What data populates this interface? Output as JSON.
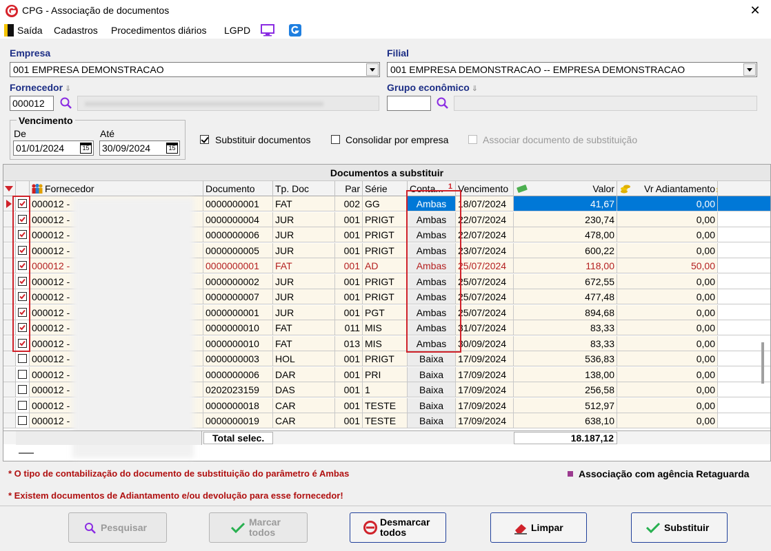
{
  "window": {
    "title": "CPG - Associação de documentos",
    "close_glyph": "✕"
  },
  "menu": [
    "Saída",
    "Cadastros",
    "Procedimentos diários",
    "LGPD"
  ],
  "form": {
    "empresa_label": "Empresa",
    "empresa_value": "001 EMPRESA DEMONSTRACAO",
    "filial_label": "Filial",
    "filial_value": "001 EMPRESA DEMONSTRACAO -- EMPRESA DEMONSTRACAO",
    "fornecedor_label": "Fornecedor",
    "fornecedor_code": "000012",
    "grupo_label": "Grupo econômico",
    "grupo_code": "",
    "vencimento_label": "Vencimento",
    "de_label": "De",
    "de_value": "01/01/2024",
    "ate_label": "Até",
    "ate_value": "30/09/2024",
    "calendar_day": "15",
    "substituir_label": "Substituir documentos",
    "consolidar_label": "Consolidar por empresa",
    "associar_label": "Associar documento de substituição"
  },
  "grid": {
    "title": "Documentos a substituir",
    "headers": {
      "fornecedor": "Fornecedor",
      "documento": "Documento",
      "tpdoc": "Tp. Doc",
      "par": "Par",
      "serie": "Série",
      "conta": "Conta...",
      "conta_sort": "1",
      "vencimento": "Vencimento",
      "valor": "Valor",
      "adiantamento": "Vr Adiantamento"
    },
    "rows": [
      {
        "checked": true,
        "fornecedor": "000012 -",
        "documento": "0000000001",
        "tpdoc": "FAT",
        "par": "002",
        "serie": "GG",
        "conta": "Ambas",
        "vencimento": "18/07/2024",
        "valor": "41,67",
        "adiantamento": "0,00",
        "red": false,
        "selected": true
      },
      {
        "checked": true,
        "fornecedor": "000012 -",
        "documento": "0000000004",
        "tpdoc": "JUR",
        "par": "001",
        "serie": "PRIGT",
        "conta": "Ambas",
        "vencimento": "22/07/2024",
        "valor": "230,74",
        "adiantamento": "0,00",
        "red": false
      },
      {
        "checked": true,
        "fornecedor": "000012 -",
        "documento": "0000000006",
        "tpdoc": "JUR",
        "par": "001",
        "serie": "PRIGT",
        "conta": "Ambas",
        "vencimento": "22/07/2024",
        "valor": "478,00",
        "adiantamento": "0,00",
        "red": false
      },
      {
        "checked": true,
        "fornecedor": "000012 -",
        "documento": "0000000005",
        "tpdoc": "JUR",
        "par": "001",
        "serie": "PRIGT",
        "conta": "Ambas",
        "vencimento": "23/07/2024",
        "valor": "600,22",
        "adiantamento": "0,00",
        "red": false
      },
      {
        "checked": true,
        "fornecedor": "000012 -",
        "documento": "0000000001",
        "tpdoc": "FAT",
        "par": "001",
        "serie": "AD",
        "conta": "Ambas",
        "vencimento": "25/07/2024",
        "valor": "118,00",
        "adiantamento": "50,00",
        "red": true
      },
      {
        "checked": true,
        "fornecedor": "000012 -",
        "documento": "0000000002",
        "tpdoc": "JUR",
        "par": "001",
        "serie": "PRIGT",
        "conta": "Ambas",
        "vencimento": "25/07/2024",
        "valor": "672,55",
        "adiantamento": "0,00",
        "red": false
      },
      {
        "checked": true,
        "fornecedor": "000012 -",
        "documento": "0000000007",
        "tpdoc": "JUR",
        "par": "001",
        "serie": "PRIGT",
        "conta": "Ambas",
        "vencimento": "25/07/2024",
        "valor": "477,48",
        "adiantamento": "0,00",
        "red": false
      },
      {
        "checked": true,
        "fornecedor": "000012 -",
        "documento": "0000000001",
        "tpdoc": "JUR",
        "par": "001",
        "serie": "PGT",
        "conta": "Ambas",
        "vencimento": "25/07/2024",
        "valor": "894,68",
        "adiantamento": "0,00",
        "red": false
      },
      {
        "checked": true,
        "fornecedor": "000012 -",
        "documento": "0000000010",
        "tpdoc": "FAT",
        "par": "011",
        "serie": "MIS",
        "conta": "Ambas",
        "vencimento": "31/07/2024",
        "valor": "83,33",
        "adiantamento": "0,00",
        "red": false
      },
      {
        "checked": true,
        "fornecedor": "000012 -",
        "documento": "0000000010",
        "tpdoc": "FAT",
        "par": "013",
        "serie": "MIS",
        "conta": "Ambas",
        "vencimento": "30/09/2024",
        "valor": "83,33",
        "adiantamento": "0,00",
        "red": false
      },
      {
        "checked": false,
        "fornecedor": "000012 -",
        "documento": "0000000003",
        "tpdoc": "HOL",
        "par": "001",
        "serie": "PRIGT",
        "conta": "Baixa",
        "vencimento": "17/09/2024",
        "valor": "536,83",
        "adiantamento": "0,00",
        "red": false
      },
      {
        "checked": false,
        "fornecedor": "000012 -",
        "documento": "0000000006",
        "tpdoc": "DAR",
        "par": "001",
        "serie": "PRI",
        "conta": "Baixa",
        "vencimento": "17/09/2024",
        "valor": "138,00",
        "adiantamento": "0,00",
        "red": false
      },
      {
        "checked": false,
        "fornecedor": "000012 -",
        "documento": "0202023159",
        "tpdoc": "DAS",
        "par": "001",
        "serie": "1",
        "conta": "Baixa",
        "vencimento": "17/09/2024",
        "valor": "256,58",
        "adiantamento": "0,00",
        "red": false
      },
      {
        "checked": false,
        "fornecedor": "000012 -",
        "documento": "0000000018",
        "tpdoc": "CAR",
        "par": "001",
        "serie": "TESTE",
        "conta": "Baixa",
        "vencimento": "17/09/2024",
        "valor": "512,97",
        "adiantamento": "0,00",
        "red": false
      },
      {
        "checked": false,
        "fornecedor": "000012 -",
        "documento": "0000000019",
        "tpdoc": "CAR",
        "par": "001",
        "serie": "TESTE",
        "conta": "Baixa",
        "vencimento": "17/09/2024",
        "valor": "638,10",
        "adiantamento": "0,00",
        "red": false
      }
    ],
    "total_label": "Total selec.",
    "total_value": "18.187,12"
  },
  "notes": {
    "note1": "* O tipo de contabilização do documento de substituição do parâmetro é Ambas",
    "note2": "* Existem documentos de Adiantamento e/ou devolução para esse fornecedor!",
    "legend": "Associação com agência Retaguarda"
  },
  "buttons": {
    "pesquisar": "Pesquisar",
    "marcar_1": "Marcar",
    "marcar_2": "todos",
    "desmarcar_1": "Desmarcar",
    "desmarcar_2": "todos",
    "limpar": "Limpar",
    "substituir": "Substituir"
  },
  "colors": {
    "accent": "#0078d7",
    "label_blue": "#1b2d85",
    "note_red": "#b01010",
    "highlight_box": "#d0222a",
    "legend": "#9b3a8f"
  }
}
